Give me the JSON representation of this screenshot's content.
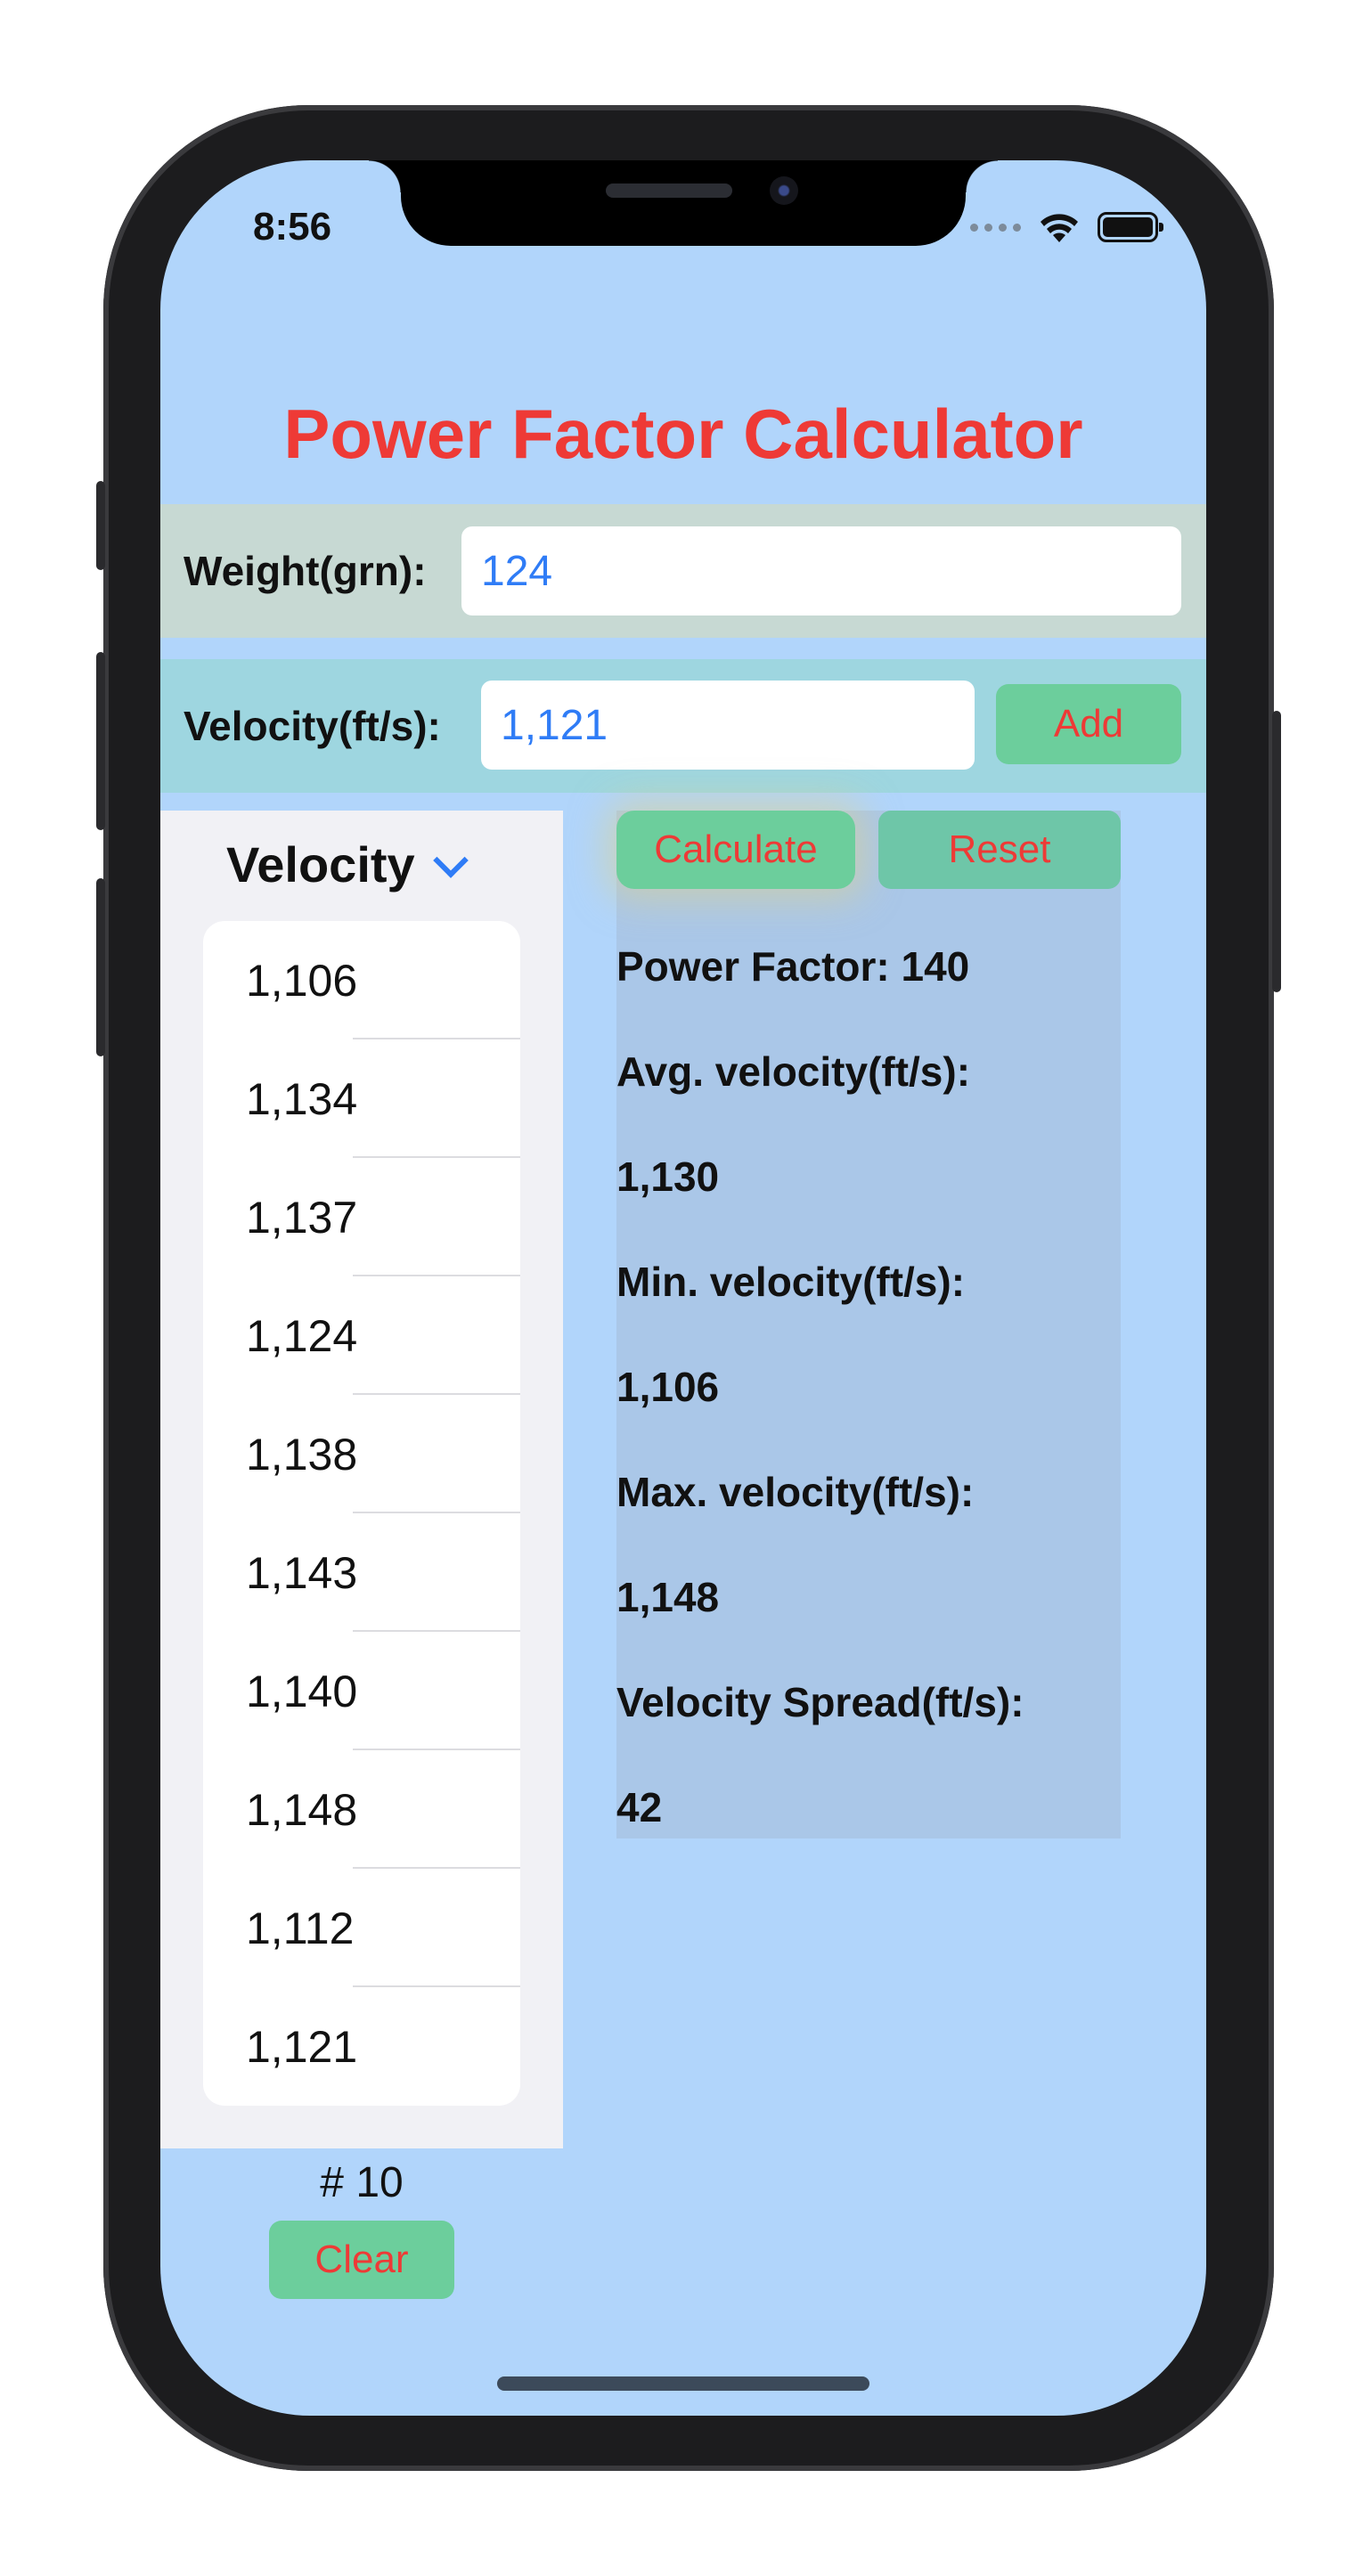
{
  "status_bar": {
    "time": "8:56"
  },
  "app": {
    "title": "Power Factor Calculator",
    "weight": {
      "label": "Weight(grn):",
      "value": "124"
    },
    "velocity": {
      "label": "Velocity(ft/s):",
      "value": "1,121",
      "add_label": "Add"
    },
    "list": {
      "header": "Velocity",
      "items": [
        "1,106",
        "1,134",
        "1,137",
        "1,124",
        "1,138",
        "1,143",
        "1,140",
        "1,148",
        "1,112",
        "1,121"
      ],
      "count": "# 10",
      "clear_label": "Clear"
    },
    "actions": {
      "calculate_label": "Calculate",
      "reset_label": "Reset"
    },
    "results": {
      "power_factor": "Power Factor:  140",
      "avg_label": "Avg. velocity(ft/s):",
      "avg_value": "1,130",
      "min_label": "Min. velocity(ft/s):",
      "min_value": "1,106",
      "max_label": "Max. velocity(ft/s):",
      "max_value": "1,148",
      "spread_label": "Velocity Spread(ft/s):",
      "spread_value": "42"
    }
  },
  "colors": {
    "screen_background": "#b1d5fb",
    "title": "#ee3a36",
    "button_fill": "#6cce9c",
    "button_text": "#ee3a36",
    "input_text": "#2f7cf6",
    "results_background": "#aac7e8"
  },
  "icons": [
    "wifi-icon",
    "battery-icon",
    "chevron-down-icon"
  ]
}
